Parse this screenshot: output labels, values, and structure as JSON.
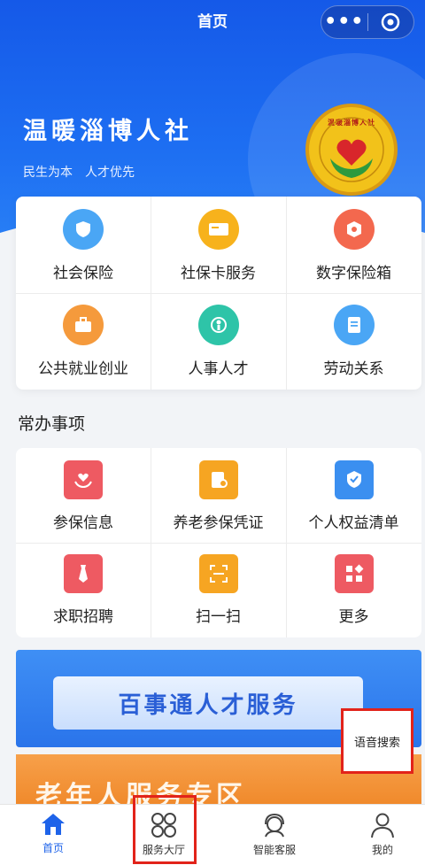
{
  "nav": {
    "title": "首页",
    "menu_icon": "more-dots-icon",
    "close_icon": "target-icon"
  },
  "hero": {
    "brand": "温暖淄博人社",
    "slogans": [
      "民生为本",
      "人才优先"
    ],
    "seal_text": "温暖淄博人社"
  },
  "main_services": [
    {
      "label": "社会保险",
      "icon": "shield-icon",
      "color": "#4aa6f5"
    },
    {
      "label": "社保卡服务",
      "icon": "card-icon",
      "color": "#f7b21c"
    },
    {
      "label": "数字保险箱",
      "icon": "safe-icon",
      "color": "#f3684e"
    },
    {
      "label": "公共就业创业",
      "icon": "briefcase-icon",
      "color": "#f59a3c"
    },
    {
      "label": "人事人才",
      "icon": "person-icon",
      "color": "#2ec4a8"
    },
    {
      "label": "劳动关系",
      "icon": "document-icon",
      "color": "#4aa6f5"
    }
  ],
  "frequent": {
    "title": "常办事项",
    "items": [
      {
        "label": "参保信息",
        "icon": "hands-heart-icon",
        "color": "#ee5a62"
      },
      {
        "label": "养老参保凭证",
        "icon": "certificate-icon",
        "color": "#f6a522"
      },
      {
        "label": "个人权益清单",
        "icon": "badge-icon",
        "color": "#3b8ff0"
      },
      {
        "label": "求职招聘",
        "icon": "tie-icon",
        "color": "#ee5a62"
      },
      {
        "label": "扫一扫",
        "icon": "scan-icon",
        "color": "#f6a522"
      },
      {
        "label": "更多",
        "icon": "grid-more-icon",
        "color": "#ee5a62"
      }
    ]
  },
  "banners": {
    "talent": "百事通人才服务",
    "elderly": "老年人服务专区"
  },
  "voice_search": "语音搜索",
  "tabbar": [
    {
      "label": "首页",
      "icon": "home-icon",
      "active": true
    },
    {
      "label": "服务大厅",
      "icon": "four-circles-icon",
      "active": false
    },
    {
      "label": "智能客服",
      "icon": "agent-icon",
      "active": false
    },
    {
      "label": "我的",
      "icon": "user-icon",
      "active": false
    }
  ]
}
